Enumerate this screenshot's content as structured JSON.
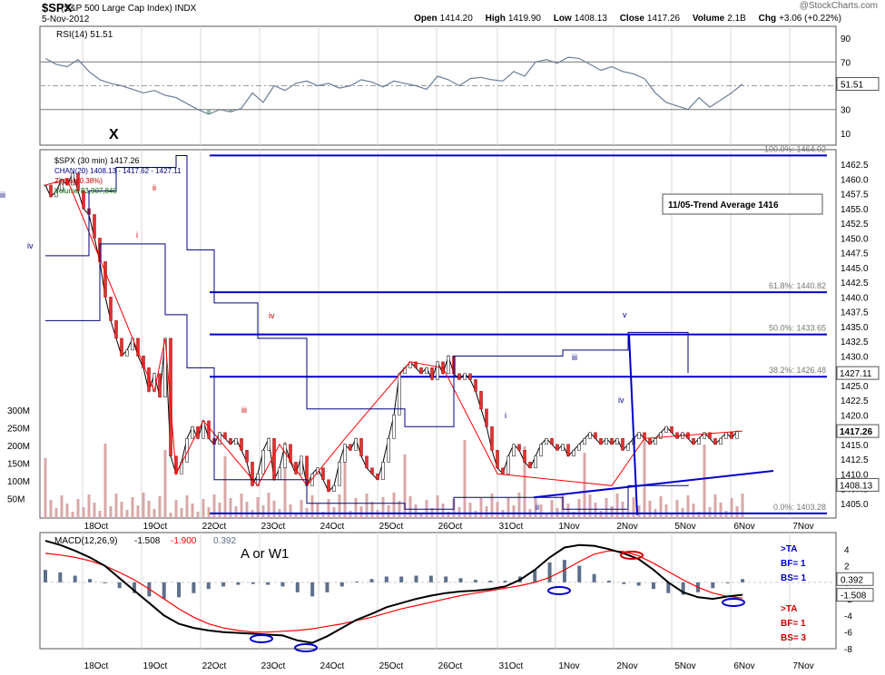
{
  "header": {
    "symbol": "$SPX",
    "name": "(S&P 500 Large Cap Index) INDX",
    "date": "5-Nov-2012",
    "brand": "@StockCharts.com",
    "quote": [
      {
        "label": "Open",
        "value": "1414.20"
      },
      {
        "label": "High",
        "value": "1419.90"
      },
      {
        "label": "Low",
        "value": "1408.13"
      },
      {
        "label": "Close",
        "value": "1417.26"
      },
      {
        "label": "Volume",
        "value": "2.1B"
      },
      {
        "label": "Chg",
        "value": "+3.06 (+0.22%)"
      }
    ]
  },
  "colors": {
    "price_channel": "#000080",
    "zigzag": "#ff0000",
    "volume": "#d8a8a8",
    "fib_line": "#0000cc",
    "rsi": "#6a7f9a",
    "rsi_fill": "#5f8f7f",
    "macd": "#000000",
    "signal": "#ff0000",
    "histogram": "#5d6f8a",
    "annotation_blue": "#0000cc",
    "annotation_red": "#cc0000"
  },
  "chart_data": [
    {
      "type": "line",
      "panel": "rsi",
      "title": "RSI(14) 51.51",
      "ylim": [
        0,
        100
      ],
      "y_ticks": [
        90,
        70,
        50,
        30,
        10
      ],
      "levels": [
        70,
        30
      ],
      "last_value_label": "51.51",
      "x": [
        0,
        4,
        8,
        12,
        16,
        20,
        24,
        28,
        32,
        36,
        40,
        44,
        48,
        52,
        56,
        60,
        64,
        68,
        72,
        76,
        80,
        84,
        88,
        92,
        96,
        100,
        104,
        108,
        112,
        116,
        120,
        124,
        128,
        132,
        136,
        140,
        144,
        148,
        152,
        156,
        160,
        164,
        168,
        172,
        176,
        180,
        184,
        188,
        192,
        196,
        200,
        204,
        208,
        212,
        216,
        220,
        224,
        228,
        232,
        236,
        240,
        244,
        248,
        252,
        256
      ],
      "values": [
        73,
        68,
        66,
        72,
        62,
        55,
        52,
        50,
        47,
        44,
        46,
        42,
        40,
        35,
        30,
        26,
        30,
        28,
        31,
        44,
        36,
        50,
        46,
        52,
        54,
        50,
        52,
        48,
        50,
        55,
        53,
        49,
        54,
        52,
        50,
        47,
        58,
        55,
        50,
        56,
        57,
        55,
        54,
        62,
        58,
        70,
        72,
        69,
        74,
        73,
        68,
        63,
        66,
        62,
        60,
        56,
        44,
        36,
        33,
        30,
        40,
        32,
        38,
        44,
        51.51
      ]
    },
    {
      "type": "line",
      "panel": "price",
      "title": "$SPX (30 min) 1417.26",
      "legend": [
        "$SPX (30 min) 1417.26",
        "CHAN(20) 1408.13 - 1417.62 - 1427.11",
        "ZigZag(0.38%)",
        "Volume 83,907,840"
      ],
      "ylim": [
        1402.5,
        1465
      ],
      "y_ticks": [
        1405,
        1407.5,
        1410,
        1412.5,
        1415,
        1417.5,
        1420,
        1422.5,
        1425,
        1427.5,
        1430,
        1432.5,
        1435,
        1437.5,
        1440,
        1442.5,
        1445,
        1447.5,
        1450,
        1452.5,
        1455,
        1457.5,
        1460,
        1462.5
      ],
      "price_labels": [
        "1427.11",
        "1417.26",
        "1408.13"
      ],
      "categories": [
        "18Oct",
        "19Oct",
        "22Oct",
        "23Oct",
        "24Oct",
        "25Oct",
        "26Oct",
        "31Oct",
        "1Nov",
        "2Nov",
        "5Nov",
        "6Nov",
        "7Nov"
      ],
      "x": [
        0,
        2,
        4,
        6,
        8,
        10,
        12,
        14,
        16,
        18,
        20,
        22,
        24,
        26,
        28,
        30,
        32,
        34,
        36,
        38,
        40,
        42,
        44,
        46,
        48,
        50,
        52,
        54,
        56,
        58,
        60,
        62,
        64,
        66,
        68,
        70,
        72,
        74,
        76,
        78,
        80,
        82,
        84,
        86,
        88,
        90,
        92,
        94,
        96,
        98,
        100,
        102,
        104,
        106,
        108,
        110,
        112,
        114,
        116,
        118,
        120,
        122,
        124,
        126,
        128,
        130,
        132,
        134,
        136,
        138,
        140,
        142,
        144,
        146,
        148,
        150,
        152,
        154,
        156,
        158,
        160,
        162,
        164,
        166,
        168,
        170,
        172,
        174,
        176,
        178,
        180,
        182,
        184,
        186,
        188,
        190,
        192,
        194,
        196,
        198,
        200,
        202,
        204,
        206,
        208,
        210,
        212,
        214,
        216,
        218,
        220,
        222,
        224,
        226,
        228,
        230,
        232,
        234,
        236,
        238,
        240,
        242,
        244,
        246,
        248,
        250,
        252,
        254,
        256
      ],
      "values": [
        1459,
        1457,
        1458,
        1460,
        1459,
        1461,
        1458,
        1455,
        1454,
        1450,
        1446,
        1440,
        1436,
        1433,
        1430,
        1431,
        1433,
        1430,
        1428,
        1424,
        1427,
        1423,
        1433,
        1413,
        1410,
        1412,
        1416,
        1418,
        1416,
        1419,
        1416,
        1415,
        1417,
        1416,
        1415,
        1416,
        1414,
        1412,
        1408,
        1410,
        1414,
        1416,
        1409,
        1411,
        1415,
        1412,
        1410,
        1413,
        1408,
        1410,
        1411,
        1409,
        1407,
        1408,
        1412,
        1415,
        1414,
        1416,
        1413,
        1411,
        1410,
        1409,
        1412,
        1416,
        1420,
        1427,
        1428,
        1429,
        1428,
        1427,
        1428,
        1426,
        1429,
        1427,
        1430,
        1427,
        1426,
        1427,
        1426,
        1424,
        1421,
        1418,
        1414,
        1411,
        1410,
        1413,
        1415,
        1414,
        1412,
        1411,
        1413,
        1415,
        1416,
        1415,
        1414,
        1415,
        1413,
        1414,
        1415,
        1416,
        1417,
        1416,
        1415,
        1416,
        1415,
        1416,
        1414,
        1415,
        1416,
        1417,
        1416,
        1415,
        1416,
        1417,
        1418,
        1417,
        1416,
        1417,
        1416,
        1415,
        1416,
        1417,
        1416,
        1415,
        1416,
        1417,
        1416,
        1417.26
      ],
      "fib_levels": [
        {
          "label": "100.0%: 1464.02",
          "value": 1464.02
        },
        {
          "label": "61.8%: 1440.82",
          "value": 1440.82
        },
        {
          "label": "50.0%: 1433.65",
          "value": 1433.65
        },
        {
          "label": "38.2%: 1426.48",
          "value": 1426.48
        },
        {
          "label": "0.0%: 1403.28",
          "value": 1403.28
        }
      ],
      "annotation_box": "11/05-Trend Average 1416",
      "wave_labels": [
        "X",
        "iii",
        "iv",
        "ii",
        "i",
        "iv",
        "iii",
        "i",
        "ii",
        "iii",
        "v",
        "iv"
      ],
      "volume_ticks": [
        "300M",
        "250M",
        "200M",
        "150M",
        "100M",
        "50M"
      ]
    },
    {
      "type": "line",
      "panel": "macd",
      "title": "MACD(12,26,9) -1.508, -1.900, 0.392",
      "title_parts": {
        "name": "MACD(12,26,9)",
        "macd": "-1.508",
        "signal": "-1.900",
        "hist": "0.392"
      },
      "ylim": [
        -8,
        6
      ],
      "y_ticks": [
        4,
        2,
        0,
        -2,
        -4,
        -6,
        -8
      ],
      "value_labels": [
        "0.392",
        "-1.508"
      ],
      "label_center": "A or W1",
      "right_blue": [
        ">TA",
        "BF= 1",
        "BS= 1"
      ],
      "right_red": [
        ">TA",
        "BF= 1",
        "BS= 3"
      ],
      "macd": [
        5,
        4.5,
        3.8,
        3,
        2,
        0.5,
        -1,
        -2.5,
        -4,
        -5,
        -5.5,
        -5.8,
        -6,
        -6.1,
        -6.2,
        -6.3,
        -6.4,
        -7,
        -7.3,
        -6.5,
        -5.5,
        -4.5,
        -3.8,
        -3,
        -2.5,
        -2,
        -1.6,
        -1.3,
        -1.1,
        -1,
        -0.8,
        -0.5,
        0.3,
        1.5,
        3,
        4.2,
        4.5,
        4.4,
        4,
        3.5,
        2.8,
        1.5,
        0,
        -1.2,
        -1.8,
        -2,
        -1.7,
        -1.508
      ],
      "signal": [
        3.5,
        3.3,
        3,
        2.6,
        2,
        1.2,
        0.3,
        -0.8,
        -2,
        -3.2,
        -4.2,
        -5,
        -5.5,
        -5.8,
        -6,
        -6,
        -5.9,
        -5.8,
        -5.6,
        -5.3,
        -5,
        -4.6,
        -4.2,
        -3.7,
        -3.2,
        -2.8,
        -2.4,
        -2,
        -1.6,
        -1.3,
        -1,
        -0.7,
        -0.4,
        0,
        0.6,
        1.5,
        2.5,
        3.4,
        3.8,
        3.7,
        3.2,
        2.3,
        1.3,
        0.3,
        -0.6,
        -1.3,
        -1.7,
        -1.9
      ]
    }
  ]
}
